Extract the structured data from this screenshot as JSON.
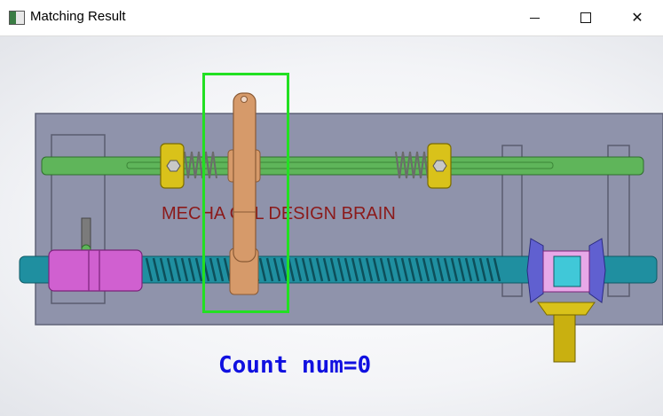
{
  "window": {
    "title": "Matching Result",
    "icon": "app-window-icon",
    "controls": [
      "minimize-icon",
      "maximize-icon",
      "close-icon"
    ]
  },
  "scene": {
    "watermark_text": "MECHA CAL DESIGN BRAIN",
    "count_text": "Count num=0",
    "colors": {
      "base_plate": "#8f93ab",
      "shaft": "#5fb55a",
      "screw": "#1f8fa0",
      "collar": "#d9c21a",
      "link": "#d69a6a",
      "coupler": "#d060d0",
      "bevel_gear": "#6060d0",
      "match_box": "#22e022",
      "count_text": "#1010e0",
      "watermark": "#8b1a1a"
    }
  }
}
